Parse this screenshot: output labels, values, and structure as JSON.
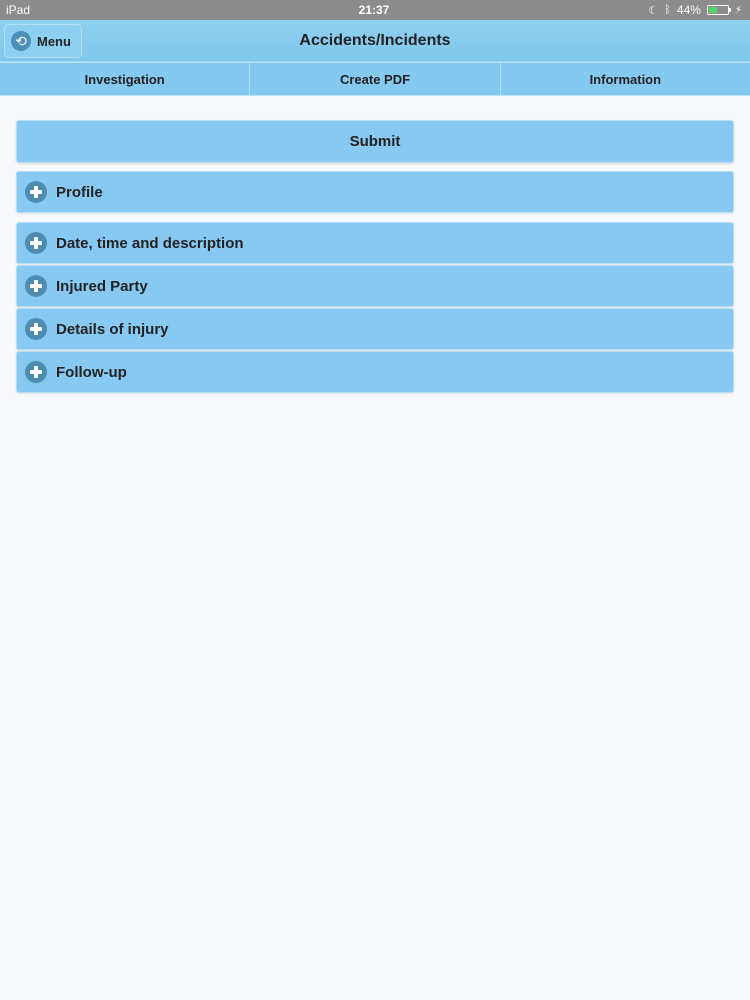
{
  "status_bar": {
    "device": "iPad",
    "time": "21:37",
    "battery": "44%",
    "battery_level": 0.44
  },
  "header": {
    "menu_label": "Menu",
    "title": "Accidents/Incidents"
  },
  "tabs": [
    {
      "label": "Investigation"
    },
    {
      "label": "Create PDF"
    },
    {
      "label": "Information"
    }
  ],
  "main": {
    "submit_label": "Submit",
    "sections": [
      {
        "label": "Profile"
      },
      {
        "label": "Date, time and description"
      },
      {
        "label": "Injured Party"
      },
      {
        "label": "Details of injury"
      },
      {
        "label": "Follow-up"
      }
    ]
  },
  "colors": {
    "accent": "#88c9f3",
    "icon": "#4e8bb0",
    "battery": "#4cd964"
  },
  "icons": {
    "menu": "back-arrow-icon",
    "section": "plus-icon"
  }
}
